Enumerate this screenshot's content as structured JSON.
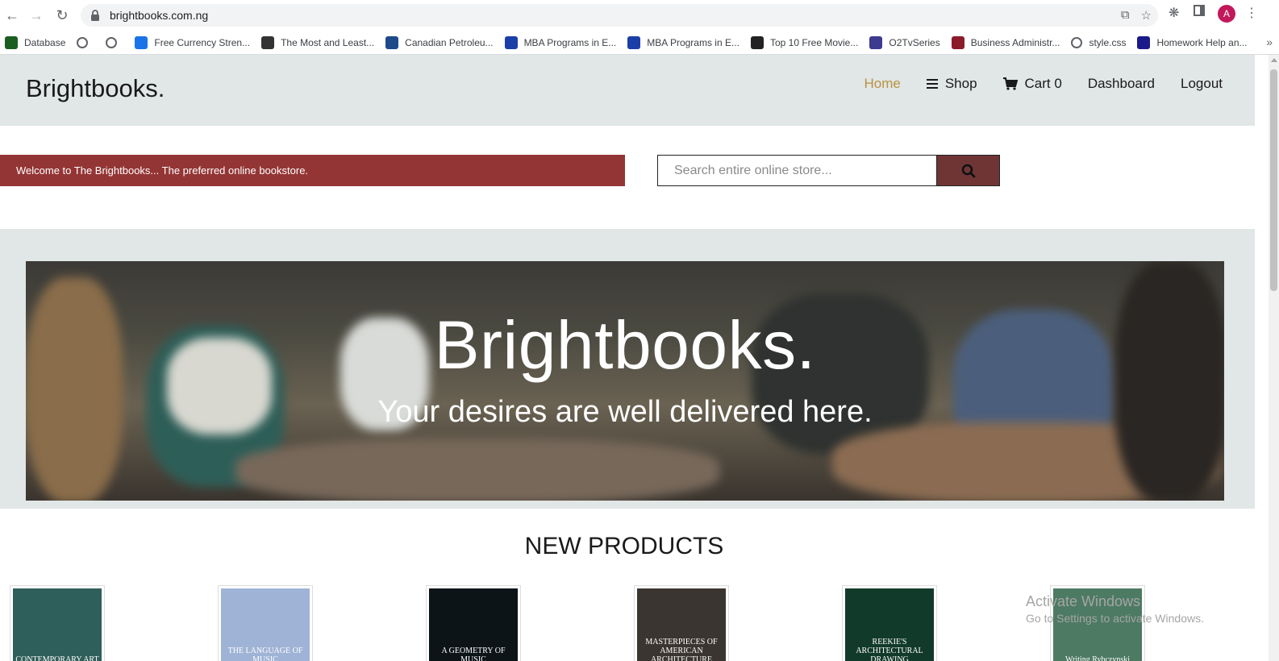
{
  "browser": {
    "url": "brightbooks.com.ng",
    "avatar_letter": "A",
    "bookmarks": [
      {
        "label": "Database",
        "icon": "leaf-icon",
        "color": "#1b5e20"
      },
      {
        "label": "",
        "icon": "globe-icon",
        "color": "#5f6368"
      },
      {
        "label": "",
        "icon": "globe-icon",
        "color": "#5f6368"
      },
      {
        "label": "Free Currency Stren...",
        "icon": "chart-icon",
        "color": "#1a73e8"
      },
      {
        "label": "The Most and Least...",
        "icon": "fx-icon",
        "color": "#333333"
      },
      {
        "label": "Canadian Petroleu...",
        "icon": "wave-icon",
        "color": "#1e4a8a"
      },
      {
        "label": "MBA Programs in E...",
        "icon": "mba-icon",
        "color": "#1a3fa8"
      },
      {
        "label": "MBA Programs in E...",
        "icon": "mba-icon",
        "color": "#1a3fa8"
      },
      {
        "label": "Top 10 Free Movie...",
        "icon": "clapper-icon",
        "color": "#222222"
      },
      {
        "label": "O2TvSeries",
        "icon": "o2-icon",
        "color": "#3b3b8f"
      },
      {
        "label": "Business Administr...",
        "icon": "flag-icon",
        "color": "#8b1a2b"
      },
      {
        "label": "style.css",
        "icon": "globe-icon",
        "color": "#5f6368"
      },
      {
        "label": "Homework Help an...",
        "icon": "b-icon",
        "color": "#1a1a8a"
      }
    ]
  },
  "site": {
    "logo": "Brightbooks.",
    "nav": {
      "home": "Home",
      "shop": "Shop",
      "cart": "Cart 0",
      "dashboard": "Dashboard",
      "logout": "Logout"
    },
    "welcome": "Welcome to The Brightbooks... The preferred online bookstore.",
    "search_placeholder": "Search entire online store...",
    "hero": {
      "title": "Brightbooks.",
      "subtitle": "Your desires are well delivered here."
    },
    "section_title": "NEW PRODUCTS",
    "products": [
      {
        "cover_text": "CONTEMPORARY ART",
        "bg": "#2f5f5a"
      },
      {
        "cover_text": "THE LANGUAGE OF MUSIC",
        "bg": "#9fb3d6"
      },
      {
        "cover_text": "A GEOMETRY OF MUSIC",
        "bg": "#0c1418"
      },
      {
        "cover_text": "MASTERPIECES OF AMERICAN ARCHITECTURE",
        "bg": "#3a3530"
      },
      {
        "cover_text": "REEKIE'S ARCHITECTURAL DRAWING",
        "bg": "#123a2a"
      },
      {
        "cover_text": "Writing Rybczynski",
        "bg": "#4d7a63"
      }
    ],
    "accent_color": "#b8933f",
    "welcome_color": "#943535"
  },
  "watermark": {
    "line1": "Activate Windows",
    "line2": "Go to Settings to activate Windows."
  }
}
